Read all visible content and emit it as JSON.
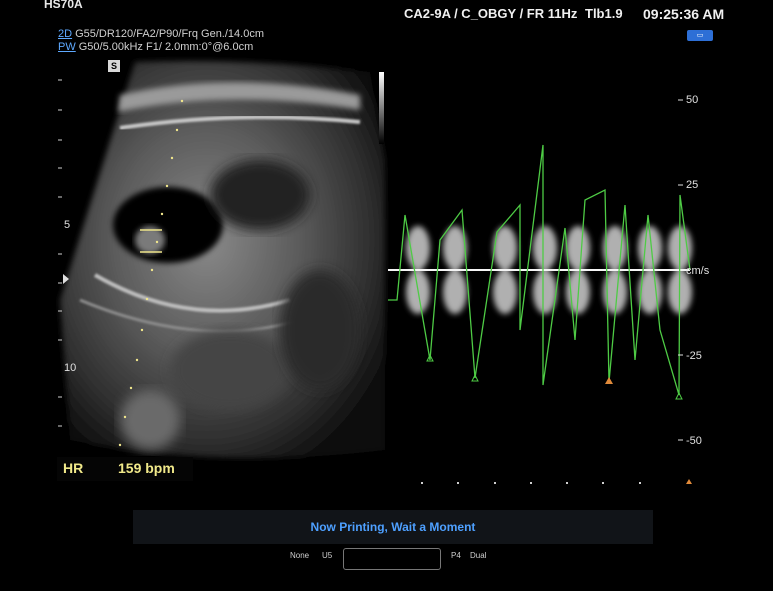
{
  "header": {
    "model": "HS70A",
    "preset": "CA2-9A / C_OBGY / FR 11Hz",
    "tib": "Tlb1.9",
    "time": "09:25:36 AM"
  },
  "params": {
    "line1_mode": "2D",
    "line1_text": "G55/DR120/FA2/P90/Frq Gen./14.0cm",
    "line2_mode": "PW",
    "line2_text": "G50/5.00kHz F1/ 2.0mm:0°@6.0cm"
  },
  "image": {
    "s_marker": "S",
    "depth_labels": [
      "5",
      "10"
    ]
  },
  "heart_rate": {
    "label": "HR",
    "value": "159 bpm"
  },
  "spectral": {
    "scale_labels": [
      "50",
      "25",
      "-25",
      "-50"
    ],
    "unit": "cm/s",
    "scale_values": [
      50,
      25,
      -25,
      -50
    ],
    "range_cm_s": [
      -60,
      60
    ],
    "trace_color": "#4ecb45"
  },
  "status": {
    "message": "Now Printing, Wait a Moment"
  },
  "footer": {
    "none_label": "None",
    "u5_label": "U5",
    "p4_label": "P4",
    "dual_label": "Dual"
  }
}
